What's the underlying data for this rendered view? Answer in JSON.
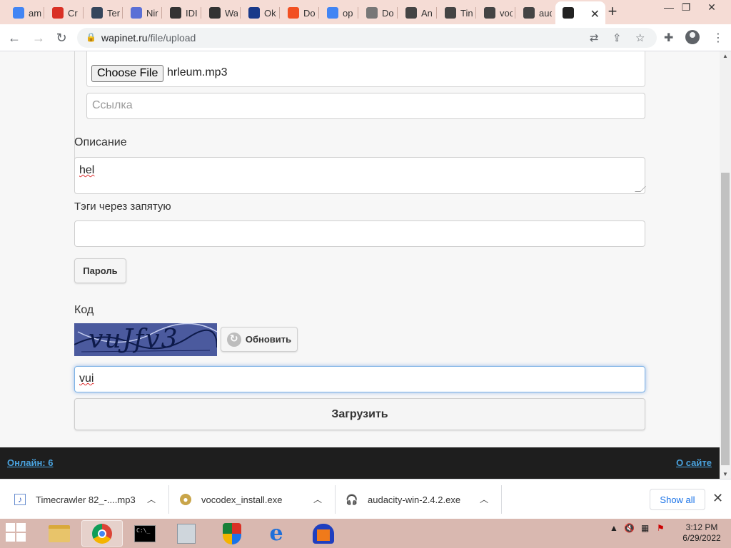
{
  "browser": {
    "tabs": [
      {
        "title": "am",
        "icon": "google-icon",
        "color": "#4285f4"
      },
      {
        "title": "Cr",
        "icon": "cr-icon",
        "color": "#d93025"
      },
      {
        "title": "Ter",
        "icon": "tumblr-icon",
        "color": "#35465c"
      },
      {
        "title": "Nir",
        "icon": "nir-icon",
        "color": "#5b6fd6"
      },
      {
        "title": "IDI",
        "icon": "genius-icon",
        "color": "#333333"
      },
      {
        "title": "Wa",
        "icon": "genius-icon",
        "color": "#333333"
      },
      {
        "title": "Ok",
        "icon": "ov-icon",
        "color": "#1a3a8a"
      },
      {
        "title": "Do",
        "icon": "microsoft-icon",
        "color": "#f25022"
      },
      {
        "title": "op",
        "icon": "google-icon",
        "color": "#4285f4"
      },
      {
        "title": "Do",
        "icon": "globe-icon",
        "color": "#777777"
      },
      {
        "title": "An",
        "icon": "site-icon",
        "color": "#444444"
      },
      {
        "title": "Tin",
        "icon": "site-icon",
        "color": "#444444"
      },
      {
        "title": "voc",
        "icon": "site-icon",
        "color": "#444444"
      },
      {
        "title": "aud",
        "icon": "site-icon",
        "color": "#444444"
      },
      {
        "title": "",
        "icon": "eye-icon",
        "color": "#222222"
      }
    ],
    "url_host": "wapinet.ru",
    "url_path": "/file/upload"
  },
  "form": {
    "choose_file_label": "Choose File",
    "file_name": "hrleum.mp3",
    "link_placeholder": "Ссылка",
    "description_label": "Описание",
    "description_value": "hel",
    "tags_label": "Тэги через запятую",
    "tags_value": "",
    "password_button": "Пароль",
    "code_label": "Код",
    "captcha_text": "vuJfv3",
    "refresh_button": "Обновить",
    "code_value": "vui",
    "upload_button": "Загрузить"
  },
  "footer": {
    "online": "Онлайн: 6",
    "about": "О сайте"
  },
  "downloads": {
    "items": [
      {
        "name": "Timecrawler 82_-....mp3",
        "icon": "audio-file-icon"
      },
      {
        "name": "vocodex_install.exe",
        "icon": "installer-icon"
      },
      {
        "name": "audacity-win-2.4.2.exe",
        "icon": "audacity-icon"
      }
    ],
    "show_all": "Show all"
  },
  "taskbar": {
    "time": "3:12 PM",
    "date": "6/29/2022"
  }
}
